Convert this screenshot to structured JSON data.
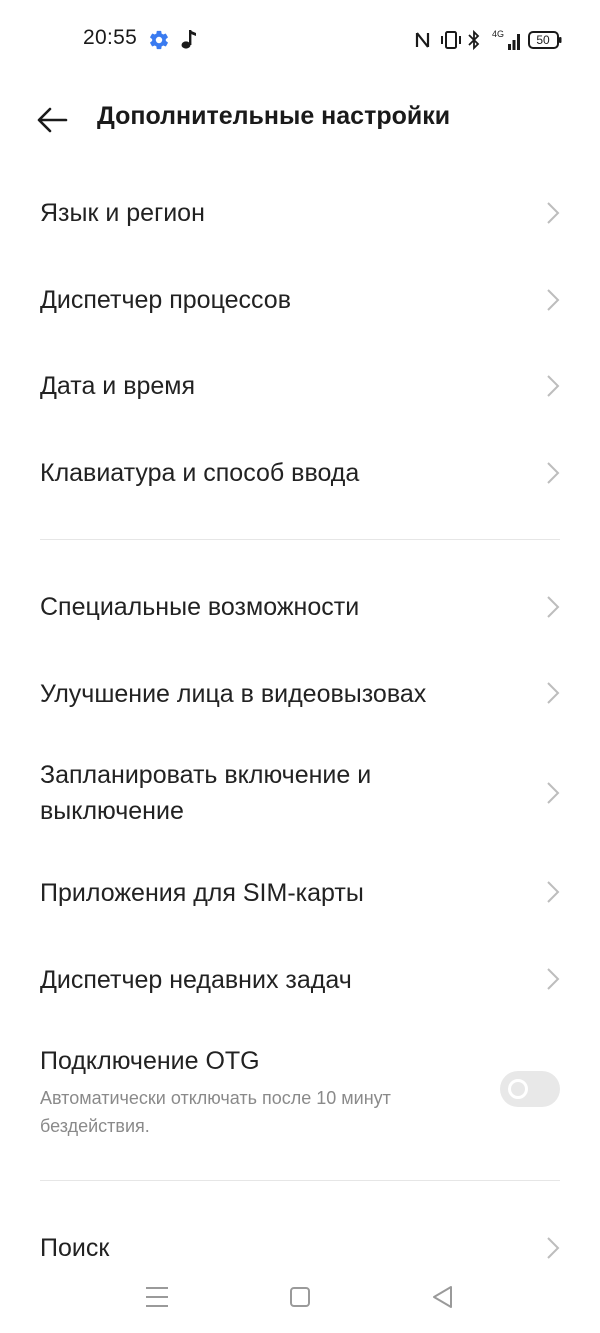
{
  "status_bar": {
    "time": "20:55",
    "battery": "50",
    "network": "4G",
    "icons": [
      "gear-icon",
      "music-note-icon",
      "nfc-icon",
      "vibrate-icon",
      "bluetooth-icon",
      "signal-icon",
      "battery-icon"
    ],
    "accent_color": "#3a7bf0"
  },
  "header": {
    "title": "Дополнительные настройки",
    "back_icon": "arrow-left-icon"
  },
  "settings": {
    "language": "Язык и регион",
    "task_manager": "Диспетчер процессов",
    "date_time": "Дата и время",
    "keyboard": "Клавиатура и способ ввода",
    "accessibility": "Специальные возможности",
    "face_beauty": "Улучшение лица в видеовызовах",
    "schedule_line1": "Запланировать включение и",
    "schedule_line2": "выключение",
    "sim_apps": "Приложения для SIM-карты",
    "recent_tasks": "Диспетчер недавних задач",
    "otg_title": "Подключение OTG",
    "otg_sub_line1": "Автоматически отключать после 10 минут",
    "otg_sub_line2": "бездействия.",
    "otg_enabled": false,
    "search": "Поиск"
  },
  "nav_bar": {
    "icons": [
      "menu-icon",
      "home-icon",
      "back-triangle-icon"
    ]
  }
}
